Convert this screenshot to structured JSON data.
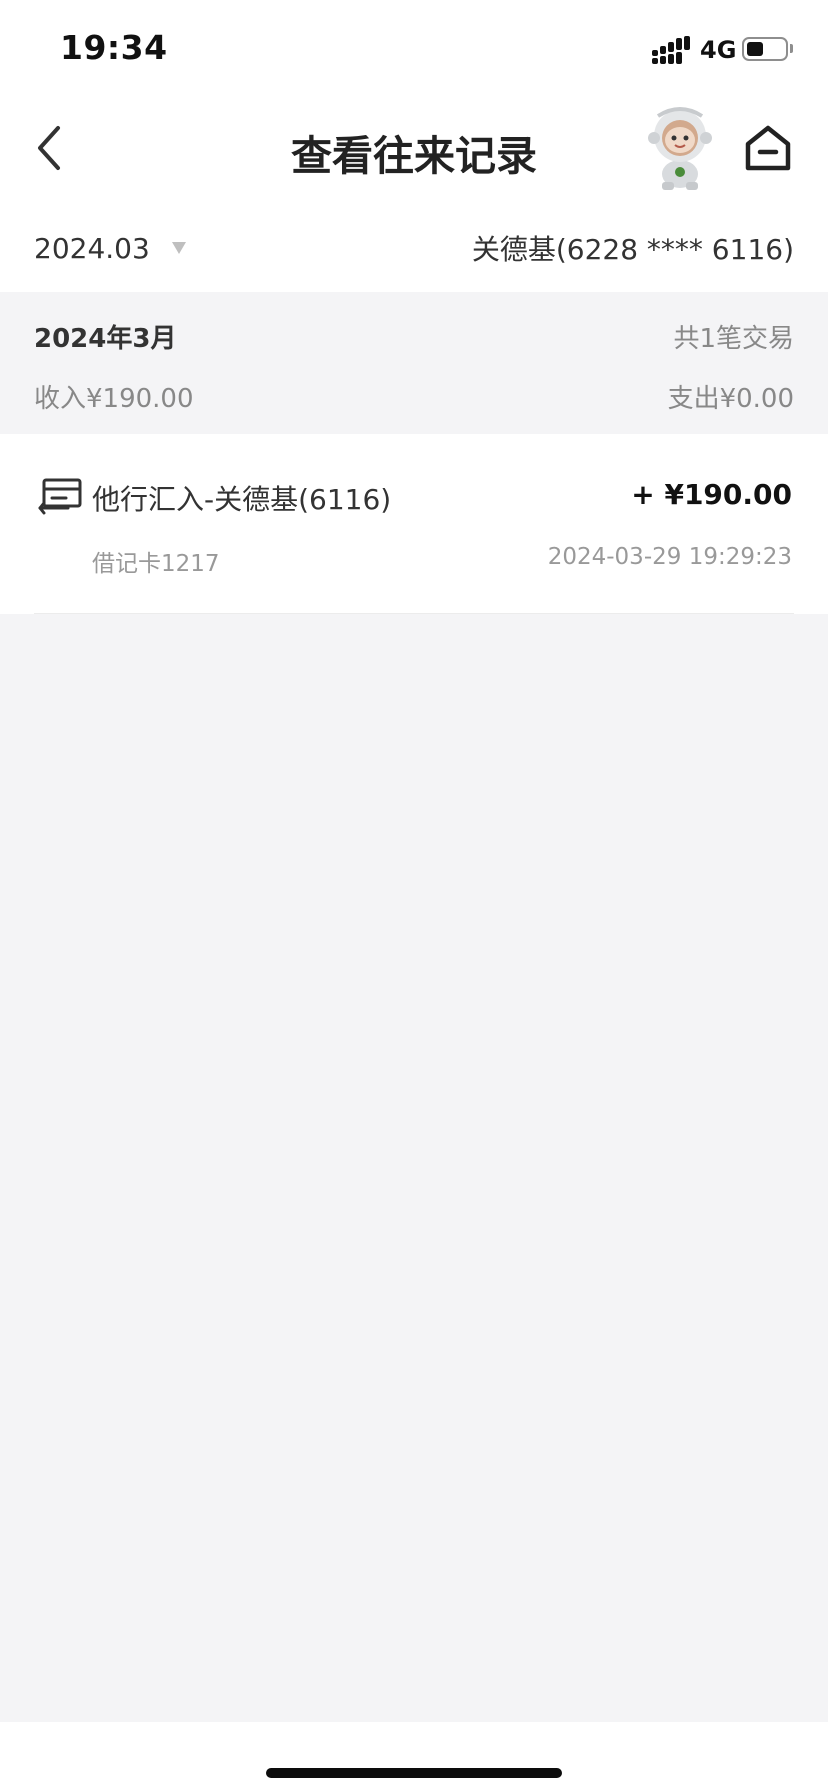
{
  "status_bar": {
    "time": "19:34",
    "network": "4G",
    "battery_level": 0.3
  },
  "nav": {
    "title": "查看往来记录",
    "back_icon": "chevron-left-icon",
    "assistant_icon": "robot-assistant-icon",
    "home_icon": "home-icon"
  },
  "filter": {
    "month": "2024.03",
    "account": "关德基(6228 **** 6116)"
  },
  "summary": {
    "month_label": "2024年3月",
    "count_label": "共1笔交易",
    "income_label": "收入¥190.00",
    "expense_label": "支出¥0.00"
  },
  "transactions": [
    {
      "title": "他行汇入-关德基(6116)",
      "amount": "+ ¥190.00",
      "card": "借记卡1217",
      "datetime": "2024-03-29 19:29:23",
      "icon": "transfer-in-icon"
    }
  ],
  "colors": {
    "background": "#f4f4f6",
    "text_primary": "#222222",
    "text_secondary": "#888888"
  }
}
